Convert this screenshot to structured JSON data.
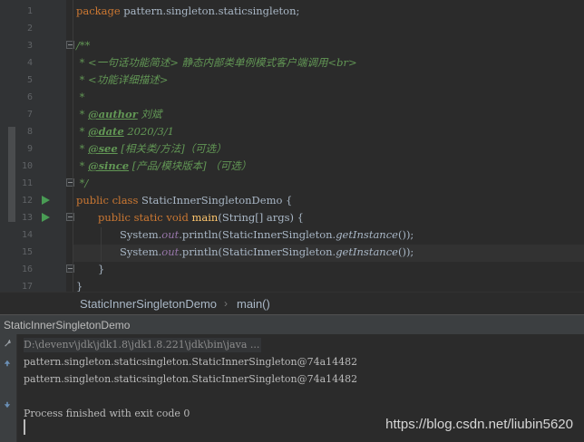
{
  "editor": {
    "line_numbers": [
      "1",
      "2",
      "3",
      "4",
      "5",
      "6",
      "7",
      "8",
      "9",
      "10",
      "11",
      "12",
      "13",
      "14",
      "15",
      "16",
      "17"
    ],
    "lines": {
      "l1": {
        "kw": "package",
        "rest": " pattern.singleton.staticsingleton;"
      },
      "l3": "/**",
      "l4": " * <一句话功能简述> 静态内部类单例模式客户端调用<br>",
      "l5": " * <功能详细描述>",
      "l6": " *",
      "l7": {
        "prefix": " * ",
        "tag": "@author",
        "text": " 刘斌"
      },
      "l8": {
        "prefix": " * ",
        "tag": "@date",
        "text": " 2020/3/1"
      },
      "l9": {
        "prefix": " * ",
        "tag": "@see",
        "text": " [相关类/方法]（可选）"
      },
      "l10": {
        "prefix": " * ",
        "tag": "@since",
        "text": " [产品/模块版本] （可选）"
      },
      "l11": " */",
      "l12": {
        "kw": "public class",
        "rest": " StaticInnerSingletonDemo {"
      },
      "l13": {
        "kw": "public static void",
        "sp": " ",
        "name": "main",
        "rest": "(String[] args) {"
      },
      "l14": {
        "a": "System.",
        "field": "out",
        "b": ".println(StaticInnerSingleton.",
        "call": "getInstance",
        "c": "());"
      },
      "l15": {
        "a": "System.",
        "field": "out",
        "b": ".println(StaticInnerSingleton.",
        "call": "getInstance",
        "c": "());"
      },
      "l16": "}",
      "l17": "}"
    }
  },
  "breadcrumb": {
    "class_name": "StaticInnerSingletonDemo",
    "separator": "›",
    "method": "main()"
  },
  "run_panel": {
    "tab_title": "StaticInnerSingletonDemo",
    "console": {
      "command": "D:\\devenv\\jdk\\jdk1.8\\jdk1.8.221\\jdk\\bin\\java ...",
      "output": [
        "pattern.singleton.staticsingleton.StaticInnerSingleton@74a14482",
        "pattern.singleton.staticsingleton.StaticInnerSingleton@74a14482"
      ],
      "exit_message": "Process finished with exit code 0"
    }
  },
  "watermark": "https://blog.csdn.net/liubin5620",
  "colors": {
    "background": "#2b2b2b",
    "keyword": "#cc7832",
    "doc_comment": "#629755",
    "method": "#ffc66d",
    "field": "#9876aa",
    "run_icon": "#499c54"
  },
  "icons": [
    "run-arrow-icon",
    "fold-icon",
    "wrench-icon",
    "arrow-up-icon",
    "arrow-down-icon"
  ]
}
